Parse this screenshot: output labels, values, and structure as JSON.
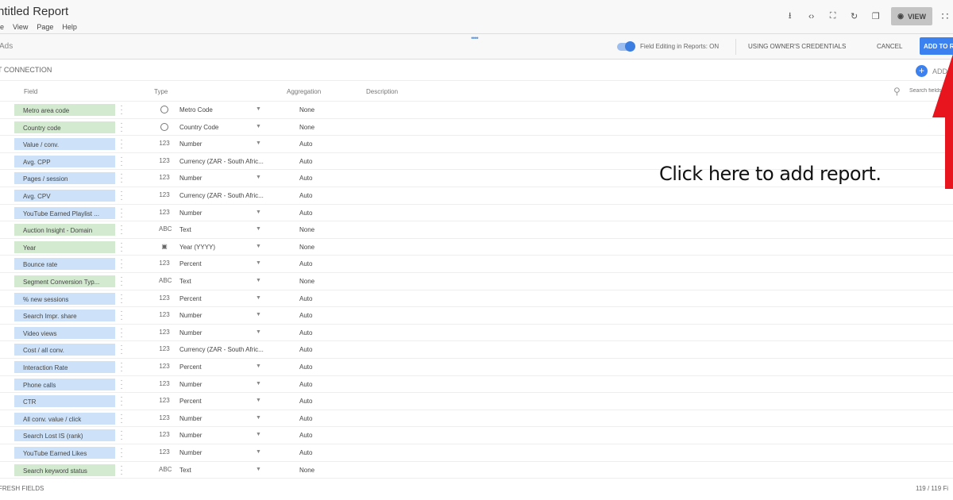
{
  "header": {
    "title": "ntitled Report",
    "menu": [
      "le",
      "View",
      "Page",
      "Help"
    ],
    "view_label": "VIEW",
    "tools": [
      "download-icon",
      "embed-icon",
      "fullscreen-icon",
      "refresh-icon",
      "copy-icon"
    ]
  },
  "datasource": {
    "name": "Ads",
    "field_editing": "Field Editing in Reports: ON",
    "field_editing_on": true,
    "credentials": "USING OWNER'S CREDENTIALS",
    "cancel": "CANCEL",
    "add_to_report": "ADD TO REPORT"
  },
  "connection": {
    "label": "T CONNECTION",
    "add_field": "ADD"
  },
  "table": {
    "headers": {
      "field": "Field",
      "type": "Type",
      "aggregation": "Aggregation",
      "description": "Description"
    },
    "search_placeholder": "Search fields",
    "rows": [
      {
        "field": "Metro area code",
        "kind": "dimension",
        "icon": "globe",
        "type": "Metro Code",
        "aggregation": "None"
      },
      {
        "field": "Country code",
        "kind": "dimension",
        "icon": "globe",
        "type": "Country Code",
        "aggregation": "None"
      },
      {
        "field": "Value / conv.",
        "kind": "metric",
        "icon": "123",
        "type": "Number",
        "aggregation": "Auto"
      },
      {
        "field": "Avg. CPP",
        "kind": "metric",
        "icon": "123",
        "type": "Currency (ZAR - South Afric...",
        "aggregation": "Auto"
      },
      {
        "field": "Pages / session",
        "kind": "metric",
        "icon": "123",
        "type": "Number",
        "aggregation": "Auto"
      },
      {
        "field": "Avg. CPV",
        "kind": "metric",
        "icon": "123",
        "type": "Currency (ZAR - South Afric...",
        "aggregation": "Auto"
      },
      {
        "field": "YouTube Earned Playlist ...",
        "kind": "metric",
        "icon": "123",
        "type": "Number",
        "aggregation": "Auto"
      },
      {
        "field": "Auction Insight - Domain",
        "kind": "dimension",
        "icon": "ABC",
        "type": "Text",
        "aggregation": "None"
      },
      {
        "field": "Year",
        "kind": "dimension",
        "icon": "calendar",
        "type": "Year (YYYY)",
        "aggregation": "None"
      },
      {
        "field": "Bounce rate",
        "kind": "metric",
        "icon": "123",
        "type": "Percent",
        "aggregation": "Auto"
      },
      {
        "field": "Segment Conversion Typ...",
        "kind": "dimension",
        "icon": "ABC",
        "type": "Text",
        "aggregation": "None"
      },
      {
        "field": "% new sessions",
        "kind": "metric",
        "icon": "123",
        "type": "Percent",
        "aggregation": "Auto"
      },
      {
        "field": "Search Impr. share",
        "kind": "metric",
        "icon": "123",
        "type": "Number",
        "aggregation": "Auto"
      },
      {
        "field": "Video views",
        "kind": "metric",
        "icon": "123",
        "type": "Number",
        "aggregation": "Auto"
      },
      {
        "field": "Cost / all conv.",
        "kind": "metric",
        "icon": "123",
        "type": "Currency (ZAR - South Afric...",
        "aggregation": "Auto"
      },
      {
        "field": "Interaction Rate",
        "kind": "metric",
        "icon": "123",
        "type": "Percent",
        "aggregation": "Auto"
      },
      {
        "field": "Phone calls",
        "kind": "metric",
        "icon": "123",
        "type": "Number",
        "aggregation": "Auto"
      },
      {
        "field": "CTR",
        "kind": "metric",
        "icon": "123",
        "type": "Percent",
        "aggregation": "Auto"
      },
      {
        "field": "All conv. value / click",
        "kind": "metric",
        "icon": "123",
        "type": "Number",
        "aggregation": "Auto"
      },
      {
        "field": "Search Lost IS (rank)",
        "kind": "metric",
        "icon": "123",
        "type": "Number",
        "aggregation": "Auto"
      },
      {
        "field": "YouTube Earned Likes",
        "kind": "metric",
        "icon": "123",
        "type": "Number",
        "aggregation": "Auto"
      },
      {
        "field": "Search keyword status",
        "kind": "dimension",
        "icon": "ABC",
        "type": "Text",
        "aggregation": "None"
      }
    ]
  },
  "footer": {
    "refresh": "FRESH FIELDS",
    "count": "119 / 119 Fi"
  },
  "annotation": {
    "text": "Click here to add report.",
    "arrow_color": "#e8141e"
  },
  "colors": {
    "dimension": "#d3ead0",
    "metric": "#cde2f8",
    "accent": "#3b82f0"
  }
}
